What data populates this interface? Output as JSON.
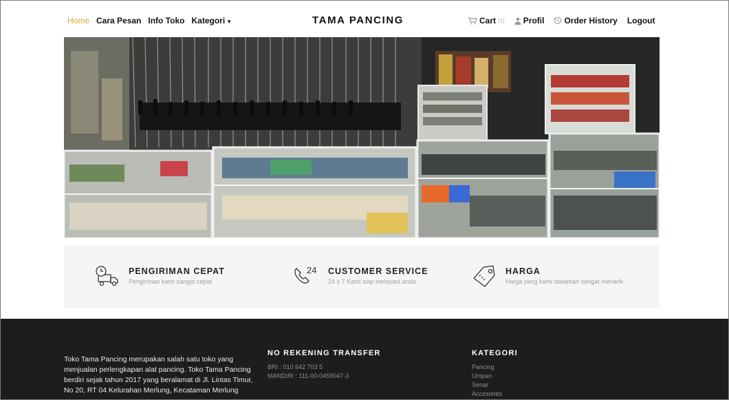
{
  "nav": {
    "left": [
      {
        "label": "Home",
        "active": true
      },
      {
        "label": "Cara Pesan"
      },
      {
        "label": "Info Toko"
      },
      {
        "label": "Kategori",
        "dropdown": true
      }
    ],
    "brand": "TAMA PANCING",
    "right": {
      "cart_label": "Cart",
      "cart_count": "(1)",
      "profile_label": "Profil",
      "history_label": "Order History",
      "logout_label": "Logout"
    }
  },
  "hero": {
    "icon": "shop-photo"
  },
  "features": [
    {
      "title": "PENGIRIMAN CEPAT",
      "subtitle": "Pengiriman kami sangat cepat",
      "icon": "delivery-truck-icon"
    },
    {
      "title": "CUSTOMER SERVICE",
      "subtitle": "24 x 7 Kami siap melayani anda",
      "icon": "phone-24-icon",
      "icon_text": "24"
    },
    {
      "title": "HARGA",
      "subtitle": "Harga yang kami tawarkan sangat menarik",
      "icon": "price-tag-icon"
    }
  ],
  "footer": {
    "about": "Toko Tama Pancing merupakan salah satu toko yang menjualan perlengkapan alat pancing. Toko Tama Pancing berdiri sejak tahun 2017 yang beralamat di Jl. Lintas Timur, No 20, RT 04 Kelurahan Merlung, Kecataman Merlung",
    "rekening": {
      "heading": "NO REKENING TRANSFER",
      "lines": [
        "BRI : 010 642 703 5",
        "MANDIRI : 111-00-0459047-3"
      ]
    },
    "kategori": {
      "heading": "KATEGORI",
      "items": [
        "Pancing",
        "Umpan",
        "Senar",
        "Accesories"
      ]
    }
  },
  "colors": {
    "accent": "#e0a43a",
    "footer_bg": "#1d1d1d",
    "features_bg": "#f5f5f5"
  }
}
